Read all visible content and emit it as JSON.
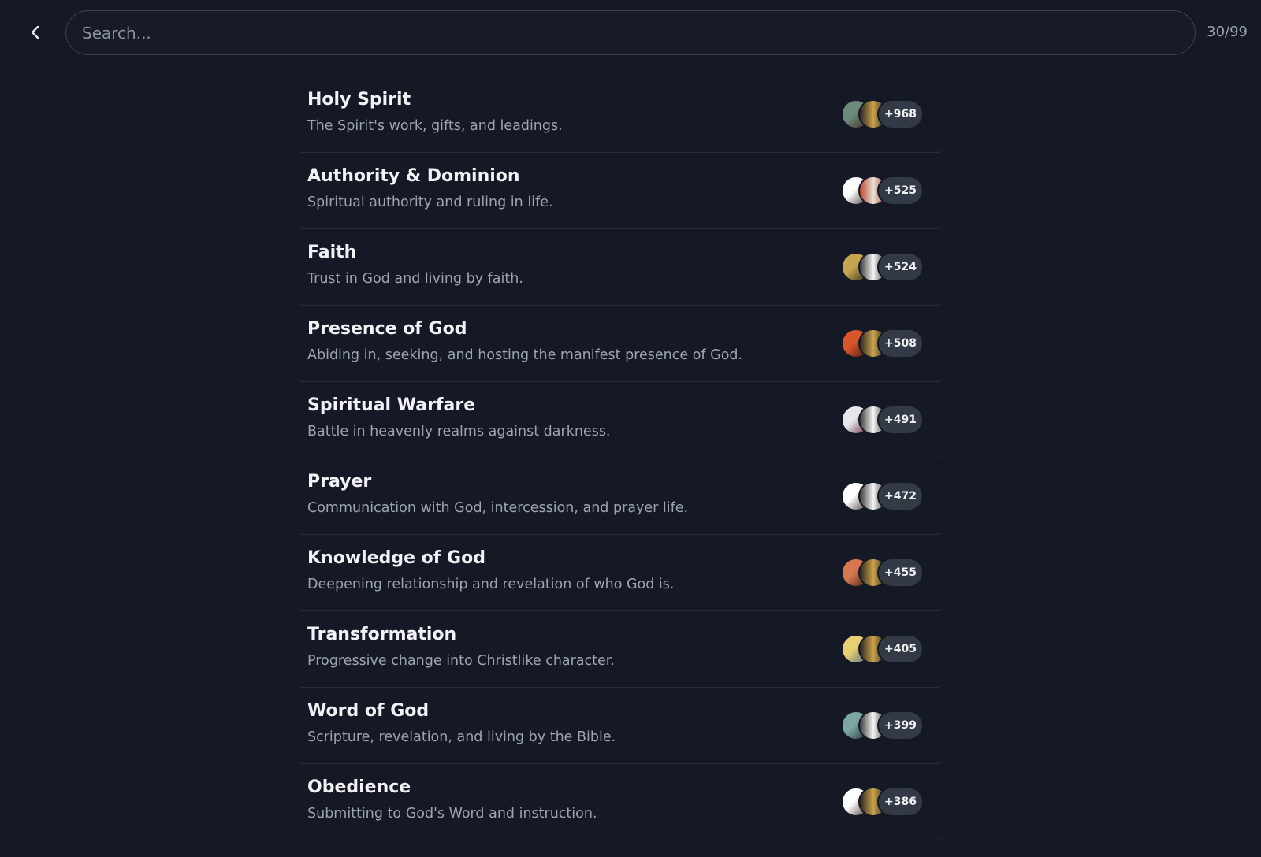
{
  "search": {
    "placeholder": "Search...",
    "value": ""
  },
  "counter": "30/99",
  "items": [
    {
      "title": "Holy Spirit",
      "description": "The Spirit's work, gifts, and leadings.",
      "count": "+968",
      "c1": [
        "#6b8a7a",
        "#3d2a20"
      ],
      "c2": [
        "#c9a24a",
        "#2a2520"
      ]
    },
    {
      "title": "Authority & Dominion",
      "description": "Spiritual authority and ruling in life.",
      "count": "+525",
      "c1": [
        "#ffffff",
        "#4a3a35"
      ],
      "c2": [
        "#e5e0d8",
        "#c0452a"
      ]
    },
    {
      "title": "Faith",
      "description": "Trust in God and living by faith.",
      "count": "+524",
      "c1": [
        "#c6a550",
        "#2f2a22"
      ],
      "c2": [
        "#f4f4f4",
        "#3a3a3a"
      ]
    },
    {
      "title": "Presence of God",
      "description": "Abiding in, seeking, and hosting the manifest presence of God.",
      "count": "+508",
      "c1": [
        "#d8542a",
        "#3a1a14"
      ],
      "c2": [
        "#c9a24a",
        "#2a2520"
      ]
    },
    {
      "title": "Spiritual Warfare",
      "description": "Battle in heavenly realms against darkness.",
      "count": "+491",
      "c1": [
        "#e6e6ec",
        "#6a2a3a"
      ],
      "c2": [
        "#f4f4f4",
        "#3a3a3a"
      ]
    },
    {
      "title": "Prayer",
      "description": "Communication with God, intercession, and prayer life.",
      "count": "+472",
      "c1": [
        "#ffffff",
        "#4a3a35"
      ],
      "c2": [
        "#f4f4f4",
        "#3a3a3a"
      ]
    },
    {
      "title": "Knowledge of God",
      "description": "Deepening relationship and revelation of who God is.",
      "count": "+455",
      "c1": [
        "#d87850",
        "#3a2218"
      ],
      "c2": [
        "#c9a24a",
        "#2a2520"
      ]
    },
    {
      "title": "Transformation",
      "description": "Progressive change into Christlike character.",
      "count": "+405",
      "c1": [
        "#e8d070",
        "#4a6a8a"
      ],
      "c2": [
        "#c9a24a",
        "#2a2520"
      ]
    },
    {
      "title": "Word of God",
      "description": "Scripture, revelation, and living by the Bible.",
      "count": "+399",
      "c1": [
        "#7aa8a0",
        "#2a2a38"
      ],
      "c2": [
        "#f4f4f4",
        "#3a3a3a"
      ]
    },
    {
      "title": "Obedience",
      "description": "Submitting to God's Word and instruction.",
      "count": "+386",
      "c1": [
        "#ffffff",
        "#4a3a35"
      ],
      "c2": [
        "#c9a24a",
        "#2a2520"
      ]
    }
  ]
}
